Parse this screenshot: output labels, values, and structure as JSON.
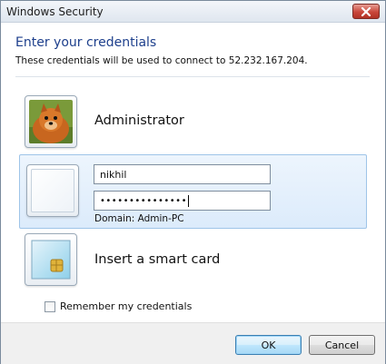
{
  "window": {
    "title": "Windows Security"
  },
  "header": {
    "heading": "Enter your credentials",
    "subtext": "These credentials will be used to connect to 52.232.167.204."
  },
  "accounts": [
    {
      "name": "Administrator",
      "icon": "pomeranian-dog-avatar-icon"
    }
  ],
  "login": {
    "username_value": "nikhil",
    "password_mask": "•••••••••••••••",
    "domain": "Domain: Admin-PC",
    "icon": "blank-user-tile-icon"
  },
  "smartcard": {
    "label": "Insert a smart card",
    "icon": "smart-card-icon"
  },
  "remember": {
    "label": "Remember my credentials",
    "checked": false
  },
  "buttons": {
    "ok": "OK",
    "cancel": "Cancel"
  },
  "colors": {
    "heading": "#1d3f8c",
    "selection": "#dcebfb",
    "close": "#c9463a"
  }
}
